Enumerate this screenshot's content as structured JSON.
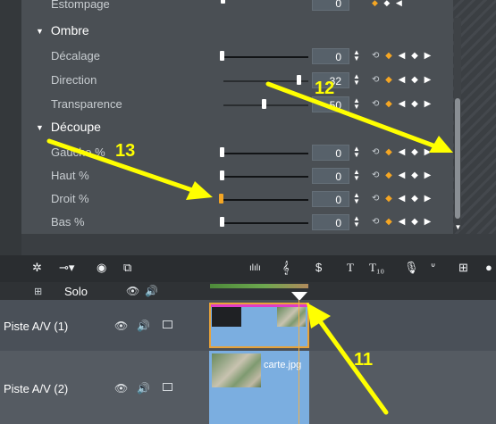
{
  "panel": {
    "top_cut_label": "Estompage",
    "sections": [
      {
        "title": "Ombre",
        "rows": [
          {
            "label": "Décalage",
            "value": "0"
          },
          {
            "label": "Direction",
            "value": "32"
          },
          {
            "label": "Transparence",
            "value": "50"
          }
        ]
      },
      {
        "title": "Découpe",
        "rows": [
          {
            "label": "Gauche %",
            "value": "0"
          },
          {
            "label": "Haut %",
            "value": "0"
          },
          {
            "label": "Droit %",
            "value": "0"
          },
          {
            "label": "Bas %",
            "value": "0"
          }
        ]
      }
    ],
    "top_cut_value": "0",
    "icons": {
      "section_toggle": "triangle-down-icon",
      "spinner": "spinner-icon",
      "reset": "reset-icon",
      "keyframe": "keyframe-diamond-icon"
    }
  },
  "toolbar": {
    "icons": [
      "gear-icon",
      "marker-dropdown-icon",
      "disc-icon",
      "snapshot-icon",
      "audio-meter-icon",
      "music-clef-icon",
      "dollar-icon",
      "text-icon",
      "title-icon",
      "microphone-icon",
      "curve-icon",
      "grid-icon",
      "circle-icon"
    ],
    "labels": {
      "text": "T",
      "title": "T₁₀"
    }
  },
  "timeline": {
    "solo_label": "Solo",
    "tracks": [
      {
        "name": "Piste A/V (1)"
      },
      {
        "name": "Piste A/V (2)",
        "clip_label": "carte.jpg"
      }
    ]
  },
  "annotations": {
    "a11": "11",
    "a12": "12",
    "a13": "13"
  },
  "colors": {
    "annotation": "#ffff00",
    "keyframe": "#f5a623",
    "clip": "#7baee0",
    "selected_clip_border": "#e03cc8"
  }
}
